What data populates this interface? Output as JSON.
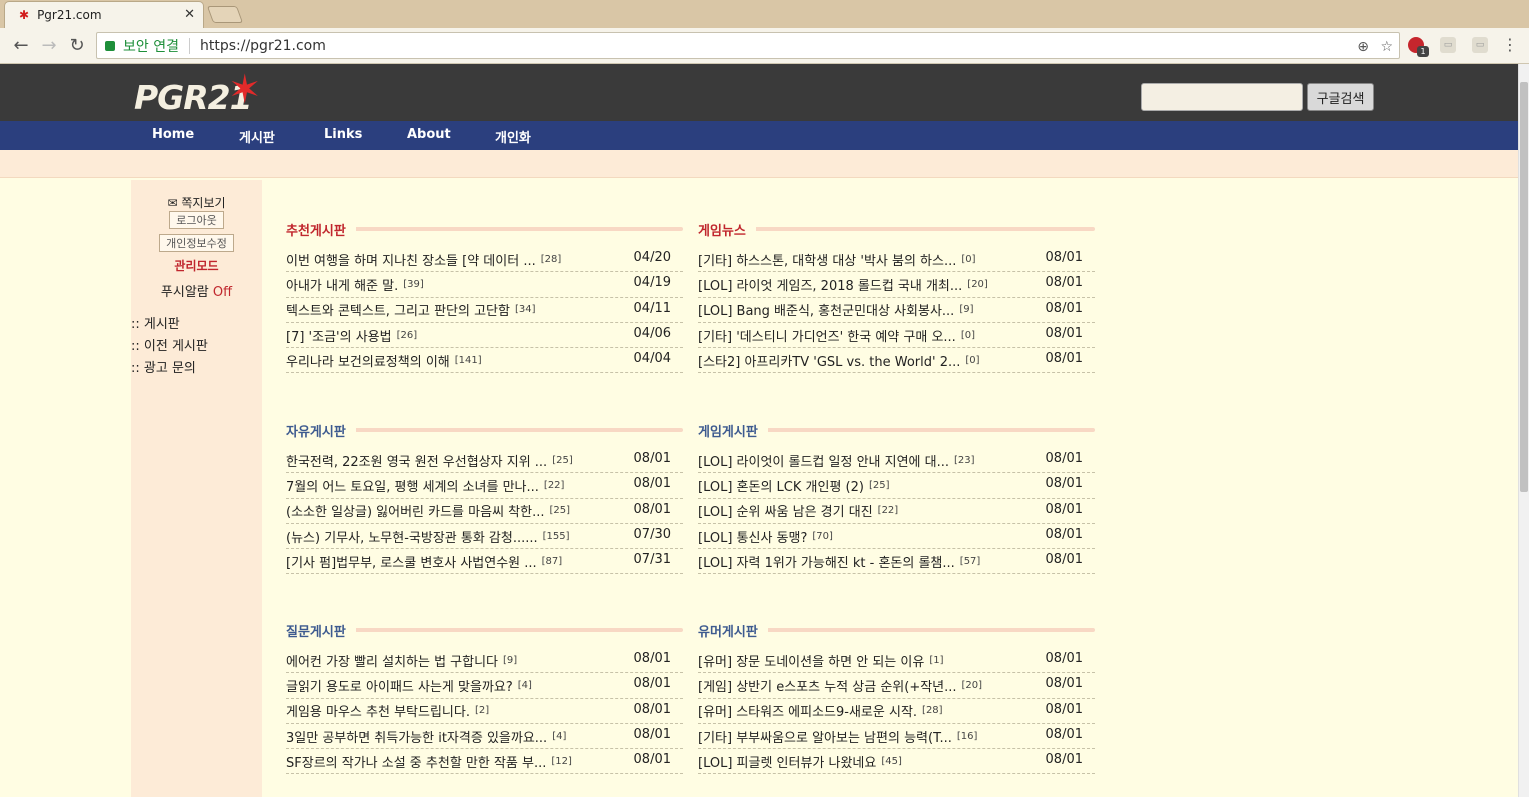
{
  "browser": {
    "tab_title": "Pgr21.com",
    "secure_label": "보안 연결",
    "url": "https://pgr21.com",
    "ext_badge": "1"
  },
  "header": {
    "logo": "PGR21",
    "search_button": "구글검색"
  },
  "nav": [
    "Home",
    "게시판",
    "Links",
    "About",
    "개인화"
  ],
  "sidebar": {
    "mail": "쪽지보기",
    "logout": "로그아웃",
    "edit_info": "개인정보수정",
    "admin": "관리모드",
    "push_label": "푸시알람",
    "push_state": "Off",
    "links": [
      ":: 게시판",
      ":: 이전 게시판",
      ":: 광고 문의"
    ]
  },
  "boards": [
    {
      "title": "추천게시판",
      "color": "red",
      "rows": [
        {
          "title": "이번 여행을 하며 지나친 장소들 [약 데이터 ...",
          "count": "[28]",
          "date": "04/20"
        },
        {
          "title": "아내가 내게 해준 말.",
          "count": "[39]",
          "date": "04/19"
        },
        {
          "title": "텍스트와 콘텍스트, 그리고 판단의 고단함",
          "count": "[34]",
          "date": "04/11"
        },
        {
          "title": "[7] '조금'의 사용법",
          "count": "[26]",
          "date": "04/06"
        },
        {
          "title": "우리나라 보건의료정책의 이해",
          "count": "[141]",
          "date": "04/04"
        }
      ]
    },
    {
      "title": "게임뉴스",
      "color": "red",
      "rows": [
        {
          "title": "[기타] 하스스톤, 대학생 대상 '박사 붐의 하스...",
          "count": "[0]",
          "date": "08/01"
        },
        {
          "title": "[LOL] 라이엇 게임즈, 2018 롤드컵 국내 개최...",
          "count": "[20]",
          "date": "08/01"
        },
        {
          "title": "[LOL] Bang 배준식, 홍천군민대상 사회봉사...",
          "count": "[9]",
          "date": "08/01"
        },
        {
          "title": "[기타] '데스티니 가디언즈' 한국 예약 구매 오...",
          "count": "[0]",
          "date": "08/01"
        },
        {
          "title": "[스타2] 아프리카TV 'GSL vs. the World' 2...",
          "count": "[0]",
          "date": "08/01"
        }
      ]
    },
    {
      "title": "자유게시판",
      "color": "blue",
      "rows": [
        {
          "title": "한국전력, 22조원 영국 원전 우선협상자 지위 ...",
          "count": "[25]",
          "date": "08/01"
        },
        {
          "title": "7월의 어느 토요일, 평행 세계의 소녀를 만나...",
          "count": "[22]",
          "date": "08/01"
        },
        {
          "title": "(소소한 일상글) 잃어버린 카드를 마음씨 착한...",
          "count": "[25]",
          "date": "08/01"
        },
        {
          "title": "(뉴스) 기무사, 노무현-국방장관 통화 감청......",
          "count": "[155]",
          "date": "07/30"
        },
        {
          "title": "[기사 펌]법무부, 로스쿨 변호사 사법연수원 ...",
          "count": "[87]",
          "date": "07/31"
        }
      ]
    },
    {
      "title": "게임게시판",
      "color": "blue",
      "rows": [
        {
          "title": "[LOL] 라이엇이 롤드컵 일정 안내 지연에 대...",
          "count": "[23]",
          "date": "08/01"
        },
        {
          "title": "[LOL] 혼돈의 LCK 개인평 (2)",
          "count": "[25]",
          "date": "08/01"
        },
        {
          "title": "[LOL] 순위 싸움 남은 경기 대진",
          "count": "[22]",
          "date": "08/01"
        },
        {
          "title": "[LOL] 통신사 동맹?",
          "count": "[70]",
          "date": "08/01"
        },
        {
          "title": "[LOL] 자력 1위가 가능해진 kt - 혼돈의 롤챔...",
          "count": "[57]",
          "date": "08/01"
        }
      ]
    },
    {
      "title": "질문게시판",
      "color": "blue",
      "rows": [
        {
          "title": "에어컨 가장 빨리 설치하는 법 구합니다",
          "count": "[9]",
          "date": "08/01"
        },
        {
          "title": "글읽기 용도로 아이패드 사는게 맞을까요?",
          "count": "[4]",
          "date": "08/01"
        },
        {
          "title": "게임용 마우스 추천 부탁드립니다.",
          "count": "[2]",
          "date": "08/01"
        },
        {
          "title": "3일만 공부하면 취득가능한 it자격증 있을까요...",
          "count": "[4]",
          "date": "08/01"
        },
        {
          "title": "SF장르의 작가나 소설 중 추천할 만한 작품 부...",
          "count": "[12]",
          "date": "08/01"
        }
      ]
    },
    {
      "title": "유머게시판",
      "color": "blue",
      "rows": [
        {
          "title": "[유머] 장문 도네이션을 하면 안 되는 이유",
          "count": "[1]",
          "date": "08/01"
        },
        {
          "title": "[게임] 상반기 e스포츠 누적 상금 순위(+작년...",
          "count": "[20]",
          "date": "08/01"
        },
        {
          "title": "[유머] 스타워즈 에피소드9-새로운 시작.",
          "count": "[28]",
          "date": "08/01"
        },
        {
          "title": "[기타] 부부싸움으로 알아보는 남편의 능력(T...",
          "count": "[16]",
          "date": "08/01"
        },
        {
          "title": "[LOL] 피글렛 인터뷰가 나왔네요",
          "count": "[45]",
          "date": "08/01"
        }
      ]
    }
  ]
}
